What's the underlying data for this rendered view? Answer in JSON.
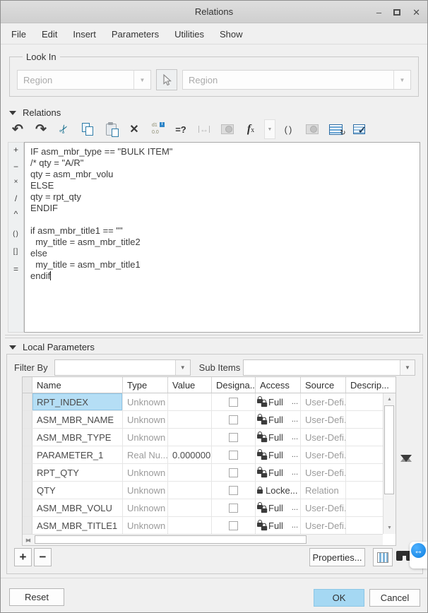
{
  "window": {
    "title": "Relations",
    "minimize": "–",
    "close": "✕"
  },
  "menu": [
    "File",
    "Edit",
    "Insert",
    "Parameters",
    "Utilities",
    "Show"
  ],
  "look_in": {
    "legend": "Look In",
    "combo1": "Region",
    "combo2": "Region"
  },
  "relations": {
    "header": "Relations",
    "toolbar": [
      {
        "name": "undo-icon",
        "glyph": "↶"
      },
      {
        "name": "redo-icon",
        "glyph": "↷"
      },
      {
        "name": "cut-icon",
        "glyph": "✂"
      },
      {
        "name": "copy-icon",
        "glyph": ""
      },
      {
        "name": "paste-icon",
        "glyph": ""
      },
      {
        "name": "delete-icon",
        "glyph": "✕"
      },
      {
        "name": "toggle-dimensions-icon",
        "glyph_top": "d1",
        "glyph_bottom": "0.0",
        "badge": "i"
      },
      {
        "name": "evaluate-icon",
        "glyph": "=?"
      },
      {
        "name": "measure-icon",
        "glyph": "↔"
      },
      {
        "name": "insert-image-icon",
        "glyph": ""
      },
      {
        "name": "function-icon",
        "glyph": "f",
        "glyph_sub": "x"
      },
      {
        "name": "function-dropdown-icon",
        "glyph": "▼"
      },
      {
        "name": "parentheses-icon",
        "glyph": "()"
      },
      {
        "name": "units-icon",
        "glyph": ""
      },
      {
        "name": "text-editor-icon",
        "glyph": "↻"
      },
      {
        "name": "verify-icon",
        "glyph": "✓"
      }
    ],
    "operators": [
      "+",
      "−",
      "×",
      "/",
      "^",
      "()",
      "[]",
      "="
    ],
    "editor_lines": [
      "IF asm_mbr_type == \"BULK ITEM\"",
      "/* qty = \"A/R\"",
      "qty = asm_mbr_volu",
      "ELSE",
      "qty = rpt_qty",
      "ENDIF",
      "",
      "if asm_mbr_title1 == \"\"",
      "  my_title = asm_mbr_title2",
      "else",
      "  my_title = asm_mbr_title1",
      "endif"
    ]
  },
  "local_parameters": {
    "header": "Local Parameters",
    "filter_by_label": "Filter By",
    "sub_items_label": "Sub Items",
    "filter_value": "",
    "sub_items_value": "",
    "columns": [
      "Name",
      "Type",
      "Value",
      "Designa...",
      "Access",
      "Source",
      "Descrip..."
    ],
    "rows": [
      {
        "name": "RPT_INDEX",
        "type": "Unknown",
        "value": "",
        "designated": false,
        "access": "Full",
        "more": "...",
        "source": "User-Defi..."
      },
      {
        "name": "ASM_MBR_NAME",
        "type": "Unknown",
        "value": "",
        "designated": false,
        "access": "Full",
        "more": "...",
        "source": "User-Defi..."
      },
      {
        "name": "ASM_MBR_TYPE",
        "type": "Unknown",
        "value": "",
        "designated": false,
        "access": "Full",
        "more": "...",
        "source": "User-Defi..."
      },
      {
        "name": "PARAMETER_1",
        "type": "Real Nu...",
        "value": "0.000000",
        "designated": false,
        "access": "Full",
        "more": "...",
        "source": "User-Defi..."
      },
      {
        "name": "RPT_QTY",
        "type": "Unknown",
        "value": "",
        "designated": false,
        "access": "Full",
        "more": "...",
        "source": "User-Defi..."
      },
      {
        "name": "QTY",
        "type": "Unknown",
        "value": "",
        "designated": false,
        "access": "Locke...",
        "more": "",
        "source": "Relation"
      },
      {
        "name": "ASM_MBR_VOLU",
        "type": "Unknown",
        "value": "",
        "designated": false,
        "access": "Full",
        "more": "...",
        "source": "User-Defi..."
      },
      {
        "name": "ASM_MBR_TITLE1",
        "type": "Unknown",
        "value": "",
        "designated": false,
        "access": "Full",
        "more": "...",
        "source": "User-Defi..."
      }
    ],
    "add_label": "+",
    "remove_label": "−",
    "properties_label": "Properties..."
  },
  "footer": {
    "reset": "Reset",
    "ok": "OK",
    "cancel": "Cancel"
  },
  "colors": {
    "selection": "#b5def5",
    "ok_fill": "#a5d8f3",
    "accent_blue": "#2e7ca8"
  }
}
